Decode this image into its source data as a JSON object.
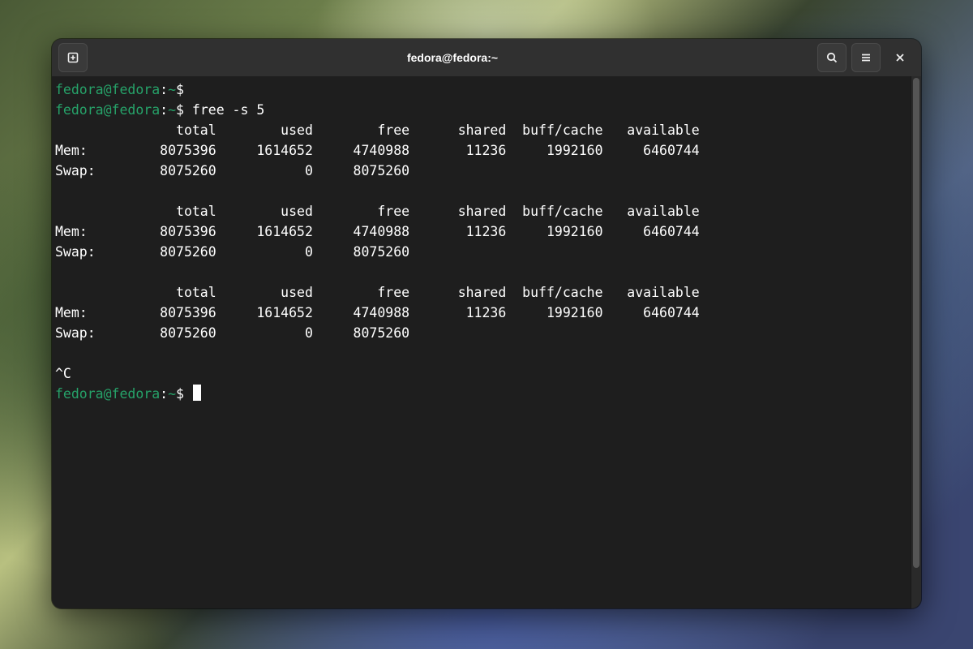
{
  "window": {
    "title": "fedora@fedora:~"
  },
  "prompt": {
    "user_host": "fedora@fedora",
    "separator": ":",
    "path": "~",
    "symbol": "$"
  },
  "commands": {
    "cmd1": "",
    "cmd2": "free -s 5"
  },
  "free_output": {
    "header": "               total        used        free      shared  buff/cache   available",
    "mem": "Mem:         8075396     1614652     4740988       11236     1992160     6460744",
    "swap": "Swap:        8075260           0     8075260"
  },
  "interrupt": "^C"
}
